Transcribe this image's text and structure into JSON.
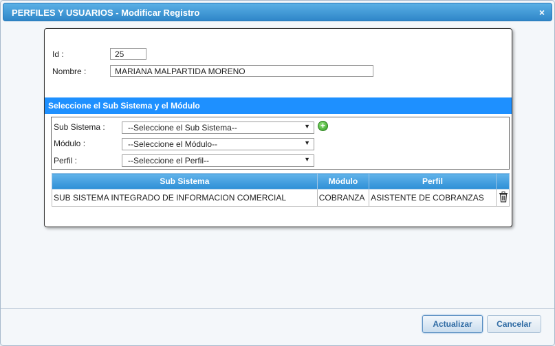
{
  "window": {
    "title": "PERFILES Y USUARIOS - Modificar Registro",
    "close_glyph": "×"
  },
  "form": {
    "id_label": "Id :",
    "id_value": "25",
    "nombre_label": "Nombre :",
    "nombre_value": "MARIANA MALPARTIDA MORENO"
  },
  "section": {
    "title": "Seleccione el Sub Sistema y el Módulo",
    "subsistema_label": "Sub Sistema :",
    "subsistema_selected": "--Seleccione el Sub Sistema--",
    "modulo_label": "Módulo :",
    "modulo_selected": "--Seleccione el Módulo--",
    "perfil_label": "Perfil :",
    "perfil_selected": "--Seleccione el Perfil--",
    "add_glyph": "+"
  },
  "table": {
    "headers": [
      "Sub Sistema",
      "Módulo",
      "Perfil",
      ""
    ],
    "rows": [
      {
        "subsistema": "SUB SISTEMA INTEGRADO DE INFORMACION COMERCIAL",
        "modulo": "COBRANZA",
        "perfil": "ASISTENTE DE COBRANZAS"
      }
    ]
  },
  "buttons": {
    "update": "Actualizar",
    "cancel": "Cancelar"
  }
}
